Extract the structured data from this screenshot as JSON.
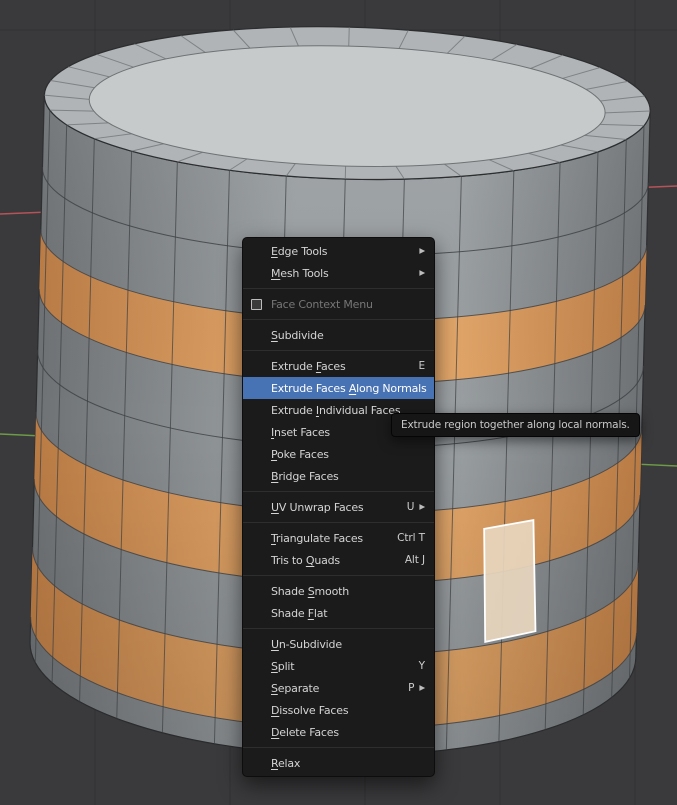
{
  "viewport": {
    "bg": "#3a3a3c",
    "grid_line": "rgba(0,0,0,0.14)",
    "axes": {
      "x_color": "#c4575c",
      "y_color": "#74a648"
    },
    "cylinder": {
      "body_edge": "#6e7275",
      "body_center": "#9ca1a4",
      "top_face": "#c7cacb",
      "rim": "#b1b4b6",
      "rim_line": "#6f7274",
      "seam_line": "#3c3f42",
      "outline": "#2b2d2f",
      "band_center": "#e3a76a",
      "band_edge": "#bb7c45",
      "active_face_fill": "#e7d5bd",
      "active_face_stroke": "#ffffff"
    }
  },
  "context_menu": {
    "highlight_color": "#4772b3",
    "items": [
      {
        "type": "item",
        "label": "Edge Tools",
        "submenu": true,
        "underline": 0
      },
      {
        "type": "item",
        "label": "Mesh Tools",
        "submenu": true,
        "underline": 0
      },
      {
        "type": "separator"
      },
      {
        "type": "item",
        "label": "Face Context Menu",
        "disabled": true,
        "icon": "menu-panel-icon"
      },
      {
        "type": "separator"
      },
      {
        "type": "item",
        "label": "Subdivide",
        "underline": 0
      },
      {
        "type": "separator"
      },
      {
        "type": "item",
        "label": "Extrude Faces",
        "shortcut": "E",
        "underline": 8
      },
      {
        "type": "item",
        "label": "Extrude Faces Along Normals",
        "highlighted": true,
        "underline": 14
      },
      {
        "type": "item",
        "label": "Extrude Individual Faces",
        "underline": 8
      },
      {
        "type": "item",
        "label": "Inset Faces",
        "underline": 0
      },
      {
        "type": "item",
        "label": "Poke Faces",
        "underline": 0
      },
      {
        "type": "item",
        "label": "Bridge Faces",
        "underline": 0
      },
      {
        "type": "separator"
      },
      {
        "type": "item",
        "label": "UV Unwrap Faces",
        "shortcut": "U",
        "submenu": true,
        "underline": 0
      },
      {
        "type": "separator"
      },
      {
        "type": "item",
        "label": "Triangulate Faces",
        "shortcut": "Ctrl T",
        "underline": 0
      },
      {
        "type": "item",
        "label": "Tris to Quads",
        "shortcut": "Alt J",
        "underline": 8
      },
      {
        "type": "separator"
      },
      {
        "type": "item",
        "label": "Shade Smooth",
        "underline": 6
      },
      {
        "type": "item",
        "label": "Shade Flat",
        "underline": 6
      },
      {
        "type": "separator"
      },
      {
        "type": "item",
        "label": "Un-Subdivide",
        "underline": 0
      },
      {
        "type": "item",
        "label": "Split",
        "shortcut": "Y",
        "underline": 0
      },
      {
        "type": "item",
        "label": "Separate",
        "shortcut": "P",
        "submenu": true,
        "underline": 0
      },
      {
        "type": "item",
        "label": "Dissolve Faces",
        "underline": 0
      },
      {
        "type": "item",
        "label": "Delete Faces",
        "underline": 0
      },
      {
        "type": "separator"
      },
      {
        "type": "item",
        "label": "Relax",
        "underline": 0
      }
    ]
  },
  "tooltip": {
    "text": "Extrude region together along local normals."
  }
}
